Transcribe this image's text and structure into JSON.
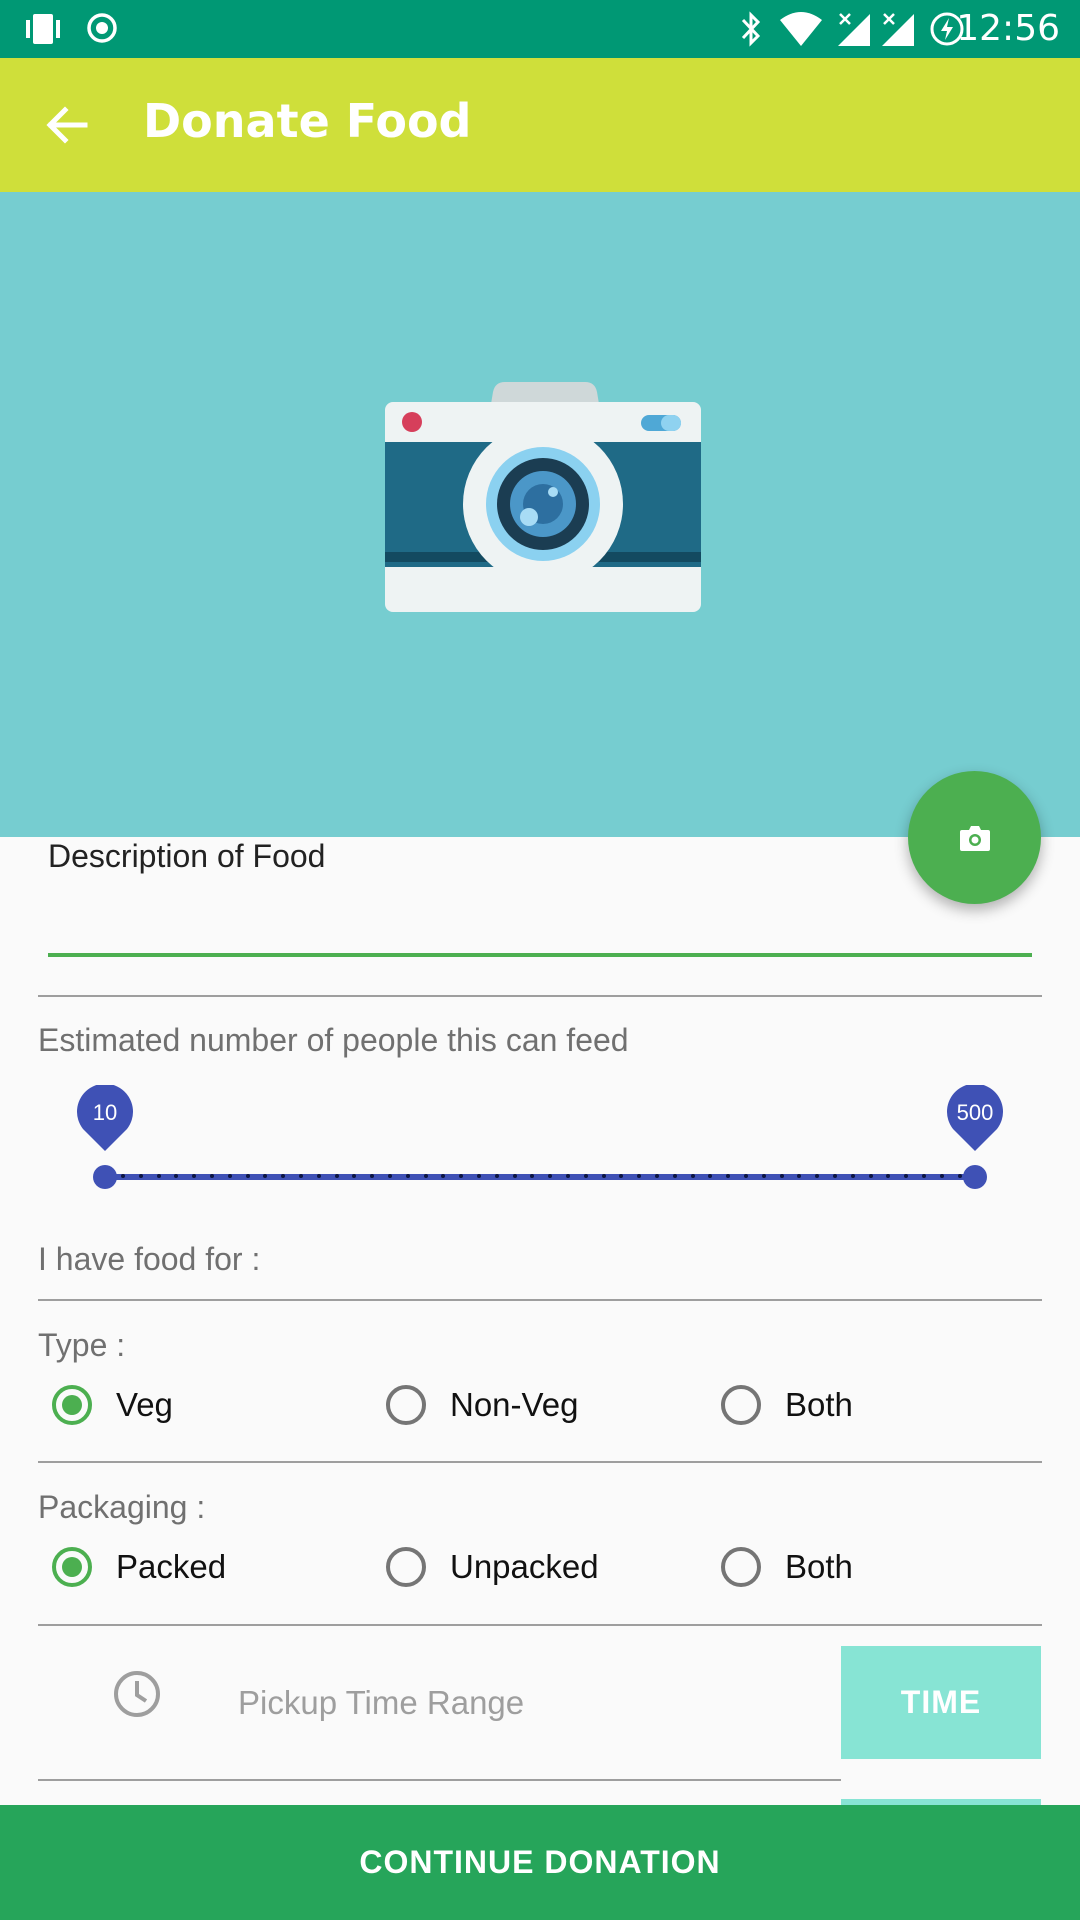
{
  "status_bar": {
    "time": "12:56"
  },
  "app_bar": {
    "title": "Donate Food"
  },
  "form": {
    "description_label": "Description of Food",
    "people_label": "Estimated number of people this can feed",
    "slider": {
      "min_value": "10",
      "max_value": "500"
    },
    "food_for_label": "I have food for :",
    "type": {
      "label": "Type :",
      "options": [
        "Veg",
        "Non-Veg",
        "Both"
      ],
      "selected": "Veg"
    },
    "packaging": {
      "label": "Packaging :",
      "options": [
        "Packed",
        "Unpacked",
        "Both"
      ],
      "selected": "Packed"
    },
    "pickup": {
      "placeholder": "Pickup Time Range",
      "button_label": "TIME"
    }
  },
  "footer": {
    "continue_label": "CONTINUE DONATION"
  },
  "colors": {
    "status_bar": "#009874",
    "app_bar": "#cfdf3a",
    "hero": "#76cdd0",
    "accent_green": "#4caf50",
    "slider": "#3f51b5",
    "time_button": "#87e4d4",
    "continue_button": "#26a55a"
  }
}
